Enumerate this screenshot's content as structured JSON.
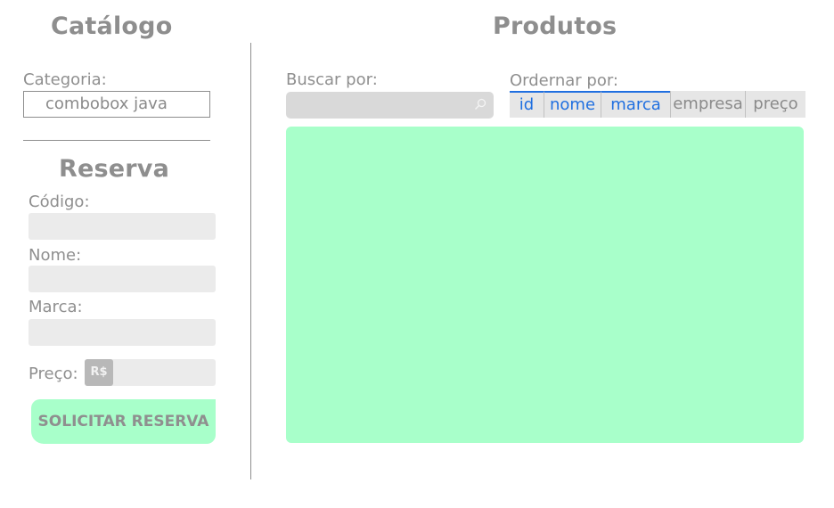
{
  "catalog": {
    "title": "Catálogo",
    "category_label": "Categoria:",
    "category_value": "combobox java"
  },
  "reservation": {
    "title": "Reserva",
    "code_label": "Código:",
    "name_label": "Nome:",
    "brand_label": "Marca:",
    "price_label": "Preço:",
    "currency_badge": "R$",
    "submit_label": "SOLICITAR RESERVA"
  },
  "products": {
    "title": "Produtos",
    "search_label": "Buscar por:",
    "search_value": "",
    "sort_label": "Ordernar por:",
    "sort_options": [
      {
        "label": "id",
        "selected": true
      },
      {
        "label": "nome",
        "selected": true
      },
      {
        "label": "marca",
        "selected": true
      },
      {
        "label": "empresa",
        "selected": false
      },
      {
        "label": "preço",
        "selected": false
      }
    ]
  },
  "colors": {
    "accent_blue": "#1f6fe0",
    "green_panel": "#a8ffca",
    "label_gray": "#8f8f8f"
  }
}
